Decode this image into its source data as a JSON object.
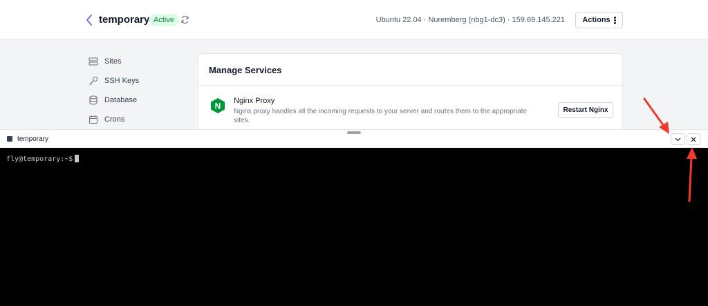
{
  "header": {
    "server_name": "temporary",
    "status": "Active",
    "meta": "Ubuntu 22.04 · Nuremberg (nbg1-dc3) · 159.69.145.221",
    "actions_label": "Actions"
  },
  "sidebar": {
    "items": [
      {
        "label": "Sites",
        "icon": "server-icon"
      },
      {
        "label": "SSH Keys",
        "icon": "key-icon"
      },
      {
        "label": "Database",
        "icon": "database-icon"
      },
      {
        "label": "Crons",
        "icon": "calendar-icon"
      }
    ]
  },
  "services": {
    "title": "Manage Services",
    "items": [
      {
        "name": "Nginx Proxy",
        "description": "Nginx proxy handles all the incoming requests to your server and routes them to the appropriate sites.",
        "action_label": "Restart Nginx",
        "icon": "nginx-logo",
        "icon_letter": "N"
      }
    ]
  },
  "terminal": {
    "title": "temporary",
    "prompt": "fly@temporary:~$"
  },
  "colors": {
    "accent": "#6366f1",
    "active_badge_bg": "#dcfce7",
    "active_badge_text": "#15803d",
    "nginx_green": "#009639",
    "annotation_red": "#ef3b2d"
  }
}
